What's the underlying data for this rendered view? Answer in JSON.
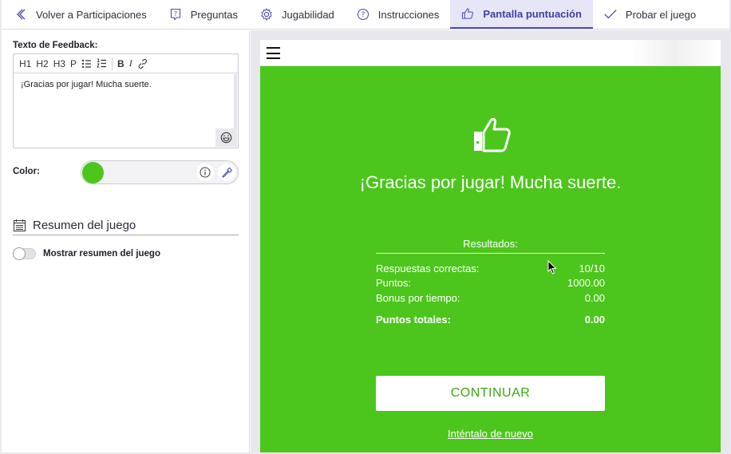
{
  "tabs": {
    "back": "Volver a Participaciones",
    "questions": "Preguntas",
    "gameplay": "Jugabilidad",
    "instructions": "Instrucciones",
    "score_screen": "Pantalla puntuación",
    "test_game": "Probar el juego",
    "active": "score_screen"
  },
  "editor": {
    "label": "Texto de Feedback:",
    "toolbar": [
      "H1",
      "H2",
      "H3",
      "P",
      "ul",
      "ol",
      "B",
      "I",
      "link"
    ],
    "content": "¡Gracias por jugar! Mucha suerte."
  },
  "color": {
    "label": "Color:",
    "value": "#4cc61c"
  },
  "summary": {
    "title": "Resumen del juego",
    "toggle_label": "Mostrar resumen del juego",
    "toggle_on": false
  },
  "preview": {
    "message": "¡Gracias por jugar! Mucha suerte.",
    "results_title": "Resultados:",
    "rows": [
      {
        "label": "Respuestas correctas:",
        "value": "10/10"
      },
      {
        "label": "Puntos:",
        "value": "1000.00"
      },
      {
        "label": "Bonus por tiempo:",
        "value": "0.00"
      }
    ],
    "total_label": "Puntos totales:",
    "total_value": "0.00",
    "continue_label": "CONTINUAR",
    "retry_label": "Inténtalo de nuevo",
    "background": "#4cc61c"
  }
}
